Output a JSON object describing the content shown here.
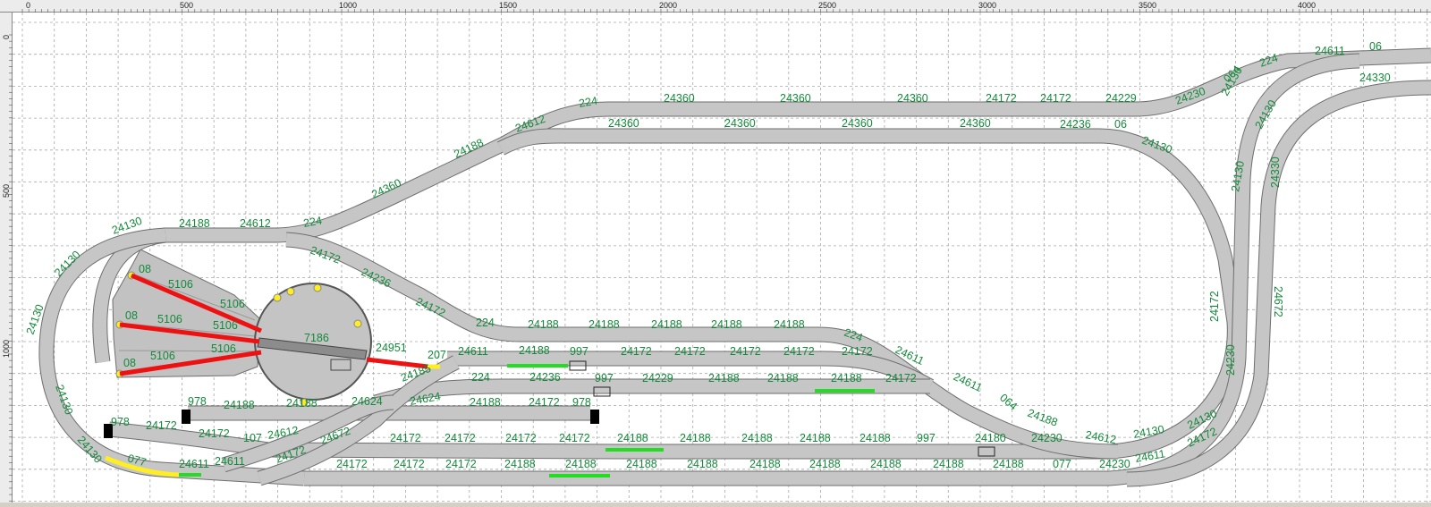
{
  "ruler": {
    "top_labels": [
      "0",
      "500",
      "1000",
      "1500",
      "2000",
      "2500",
      "3000",
      "3500",
      "4000"
    ],
    "left_labels": [
      "0",
      "500",
      "1000"
    ]
  },
  "turntable": {
    "center_label": "7186",
    "stall_numbers": [
      "08",
      "08",
      "08"
    ],
    "stall_tracks": [
      "5106",
      "5106",
      "5106",
      "5106",
      "5106",
      "5106"
    ]
  },
  "track_labels": [
    "24130",
    "24188",
    "24612",
    "224",
    "24360",
    "24188",
    "24612",
    "224",
    "24360",
    "24360",
    "24360",
    "24172",
    "24172",
    "24229",
    "24230",
    "064",
    "224",
    "24611",
    "06",
    "24360",
    "24360",
    "24360",
    "24360",
    "24236",
    "06",
    "24130",
    "24130",
    "24330",
    "24130",
    "24130",
    "24130",
    "24130",
    "24130",
    "24172",
    "24236",
    "24172",
    "224",
    "24188",
    "24188",
    "24188",
    "24188",
    "24188",
    "224",
    "24611",
    "24611",
    "064",
    "24188",
    "24612",
    "24130",
    "24130",
    "24951",
    "207",
    "24611",
    "24188",
    "997",
    "24172",
    "24172",
    "24172",
    "24172",
    "24172",
    "24185",
    "224",
    "24236",
    "997",
    "24229",
    "24188",
    "24188",
    "24188",
    "24172",
    "978",
    "24188",
    "24188",
    "24624",
    "24624",
    "24188",
    "24172",
    "978",
    "978",
    "24172",
    "24172",
    "107",
    "24612",
    "24672",
    "24172",
    "24172",
    "24172",
    "24172",
    "24188",
    "24188",
    "24188",
    "24188",
    "24188",
    "997",
    "24180",
    "24230",
    "077",
    "24611",
    "24611",
    "24172",
    "24172",
    "24172",
    "24172",
    "24188",
    "24188",
    "24188",
    "24188",
    "24188",
    "24188",
    "24188",
    "24188",
    "24188",
    "077",
    "24230",
    "24611",
    "24172",
    "24172",
    "24672",
    "24230",
    "24130",
    "24330"
  ],
  "colors": {
    "canvas": "#ffffff",
    "grid": "#a8a8a8",
    "track_fill": "#c6c6c6",
    "track_edge": "#6e6e6e",
    "label": "#138a3a",
    "siding_red": "#ee1111",
    "section_green": "#22dd22",
    "highlight_yellow": "#ffee22"
  }
}
